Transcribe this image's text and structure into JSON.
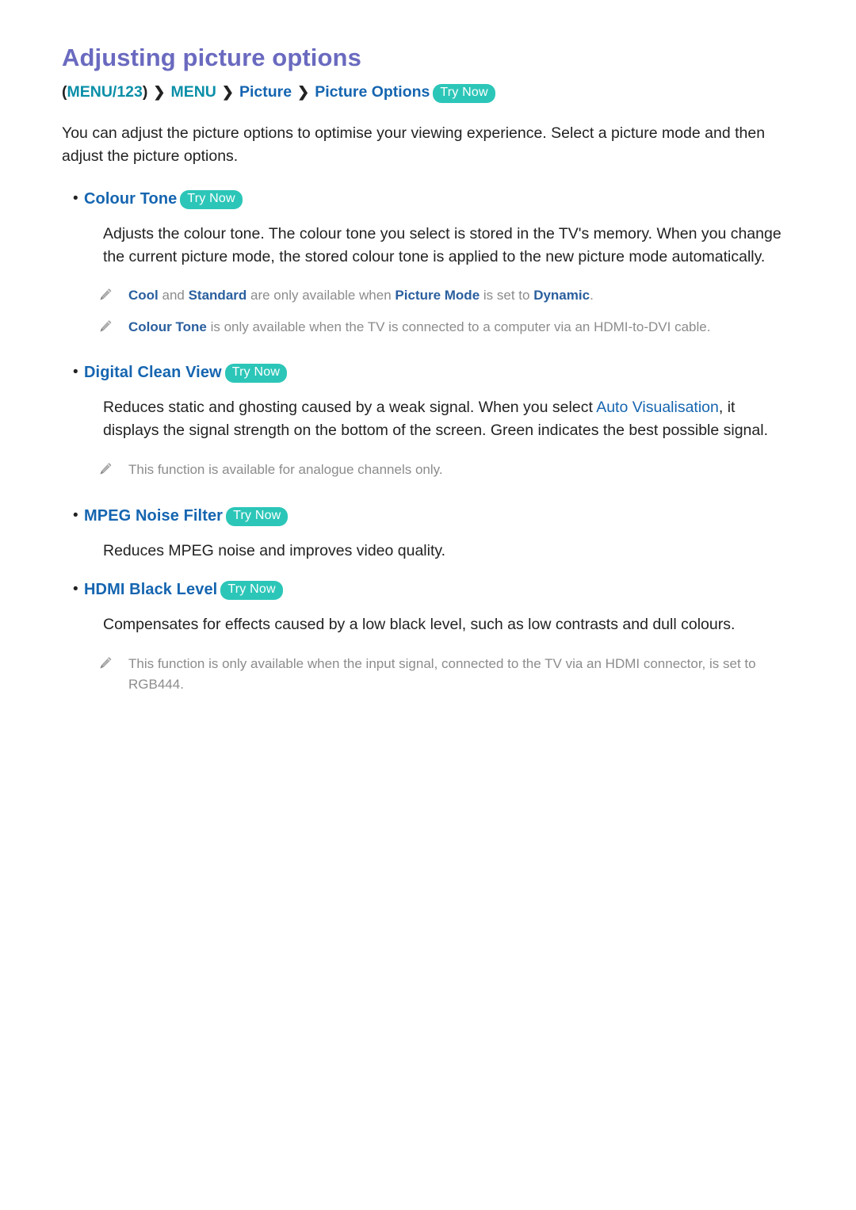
{
  "page": {
    "title": "Adjusting picture options",
    "title_color": "#6a6ac0",
    "heading_color": "#1565b0",
    "try_now_badge_color": "#2cc6b8",
    "note_text_color": "#8c8c8c"
  },
  "breadcrumb": {
    "open_paren": "(",
    "menu123": "MENU/123",
    "close_paren": ")",
    "separator": "❯",
    "menu": "MENU",
    "picture": "Picture",
    "picture_options": "Picture Options",
    "try_now": "Try Now"
  },
  "intro": "You can adjust the picture options to optimise your viewing experience. Select a picture mode and then adjust the picture options.",
  "sections": [
    {
      "heading": "Colour Tone",
      "try_now": "Try Now",
      "body": "Adjusts the colour tone. The colour tone you select is stored in the TV's memory. When you change the current picture mode, the stored colour tone is applied to the new picture mode automatically.",
      "notes": [
        {
          "icon": "pencil-icon",
          "parts": [
            {
              "text": "Cool",
              "bold": true
            },
            {
              "text": " and ",
              "bold": false
            },
            {
              "text": "Standard",
              "bold": true
            },
            {
              "text": " are only available when ",
              "bold": false
            },
            {
              "text": "Picture Mode",
              "bold": true
            },
            {
              "text": " is set to ",
              "bold": false
            },
            {
              "text": "Dynamic",
              "bold": true
            },
            {
              "text": ".",
              "bold": false
            }
          ]
        },
        {
          "icon": "pencil-icon",
          "parts": [
            {
              "text": "Colour Tone",
              "bold": true
            },
            {
              "text": " is only available when the TV is connected to a computer via an HDMI-to-DVI cable.",
              "bold": false
            }
          ]
        }
      ]
    },
    {
      "heading": "Digital Clean View",
      "try_now": "Try Now",
      "body_parts": [
        {
          "text": "Reduces static and ghosting caused by a weak signal. When you select ",
          "highlight": false
        },
        {
          "text": "Auto Visualisation",
          "highlight": true
        },
        {
          "text": ", it displays the signal strength on the bottom of the screen. Green indicates the best possible signal.",
          "highlight": false
        }
      ],
      "notes": [
        {
          "icon": "pencil-icon",
          "parts": [
            {
              "text": "This function is available for analogue channels only.",
              "bold": false
            }
          ]
        }
      ]
    },
    {
      "heading": "MPEG Noise Filter",
      "try_now": "Try Now",
      "body": "Reduces MPEG noise and improves video quality.",
      "notes": []
    },
    {
      "heading": "HDMI Black Level",
      "try_now": "Try Now",
      "body": "Compensates for effects caused by a low black level, such as low contrasts and dull colours.",
      "notes": [
        {
          "icon": "pencil-icon",
          "parts": [
            {
              "text": "This function is only available when the input signal, connected to the TV via an HDMI connector, is set to RGB444.",
              "bold": false
            }
          ]
        }
      ]
    }
  ]
}
